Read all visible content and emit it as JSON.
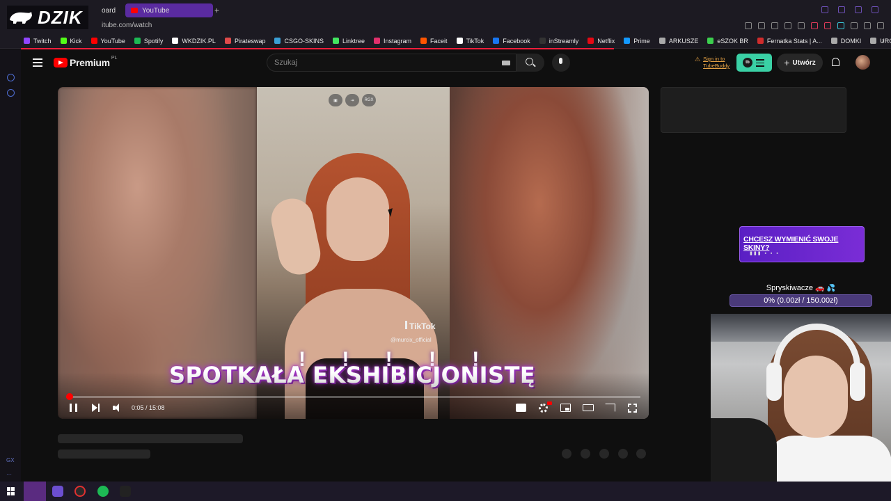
{
  "browser": {
    "tabs": [
      {
        "label": "oard",
        "active": false
      },
      {
        "label": "YouTube",
        "active": true
      }
    ],
    "new_tab_symbol": "+",
    "url": "itube.com/watch",
    "overlay_logo": "DZIK",
    "bookmarks": [
      {
        "label": "Twitch",
        "color": "#9146ff"
      },
      {
        "label": "Kick",
        "color": "#53fc18"
      },
      {
        "label": "YouTube",
        "color": "#ff0000"
      },
      {
        "label": "Spotify",
        "color": "#1db954"
      },
      {
        "label": "WKDZIK.PL",
        "color": "#ffffff"
      },
      {
        "label": "Pirateswap",
        "color": "#e04a4a"
      },
      {
        "label": "CSGO-SKINS",
        "color": "#3a9fd6"
      },
      {
        "label": "Linktree",
        "color": "#43e660"
      },
      {
        "label": "Instagram",
        "color": "#e1306c"
      },
      {
        "label": "Faceit",
        "color": "#ff5500"
      },
      {
        "label": "TikTok",
        "color": "#ffffff"
      },
      {
        "label": "Facebook",
        "color": "#1877f2"
      },
      {
        "label": "inStreamly",
        "color": "#333333"
      },
      {
        "label": "Netflix",
        "color": "#e50914"
      },
      {
        "label": "Prime",
        "color": "#1399ff"
      },
      {
        "label": "ARKUSZE",
        "color": "#aaaaaa"
      },
      {
        "label": "eSZOK BR",
        "color": "#3ccf4e"
      },
      {
        "label": "Fernatka Stats | A...",
        "color": "#d02c2c"
      },
      {
        "label": "DOMKI",
        "color": "#aaaaaa"
      },
      {
        "label": "URO",
        "color": "#aaaaaa"
      }
    ]
  },
  "youtube": {
    "logo_text": "Premium",
    "region": "PL",
    "search_placeholder": "Szukaj",
    "tubebuddy_sign_in": "Sign in to TubeBuddy",
    "create_label": "Utwórz",
    "player": {
      "caption": "SPOTKAŁA EKSHIBICJONISTĘ",
      "exclamations": "! ! ! ! !",
      "watermark_brand": "TikTok",
      "watermark_user": "@murcix_official",
      "overlay_button_label": "RGX",
      "current_time": "0:05",
      "duration": "15:08",
      "time_display": "0:05 / 15:08",
      "progress_fraction": 0.0055
    }
  },
  "stream_overlay": {
    "promo_text": "CHCESZ WYMIENIĆ SWOJE SKINY?",
    "promo_sub": "▮▮▮ ▪ ▪ ▪",
    "goal_title": "Spryskiwacze 🚗",
    "goal_icon": "💦",
    "goal_progress": "0% (0.00zł / 150.00zł)",
    "goal_fraction": 0
  },
  "sidebar_strip": {
    "bottom_label": "GX"
  },
  "colors": {
    "accent": "#ff0000",
    "tab_active": "#5a2ba0",
    "tubebuddy": "#3ad1a5",
    "promo": "#6a26cc"
  }
}
